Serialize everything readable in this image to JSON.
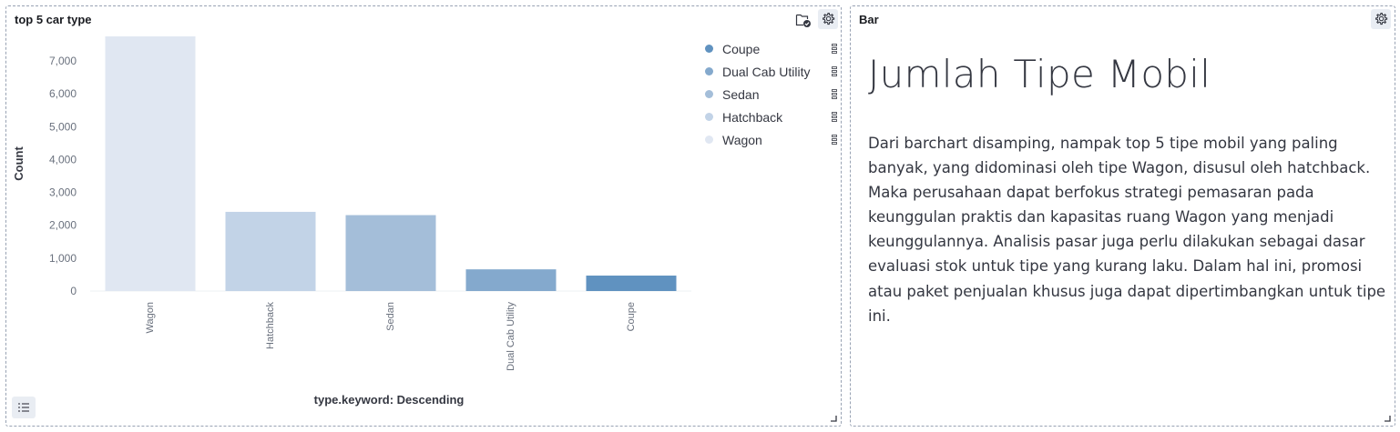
{
  "left_panel": {
    "title": "top 5 car type",
    "x_axis_title": "type.keyword: Descending",
    "y_axis_title": "Count",
    "legend": [
      {
        "label": "Coupe",
        "color": "#6092c0"
      },
      {
        "label": "Dual Cab Utility",
        "color": "#84a9cd"
      },
      {
        "label": "Sedan",
        "color": "#a4bed9"
      },
      {
        "label": "Hatchback",
        "color": "#c2d3e7"
      },
      {
        "label": "Wagon",
        "color": "#e0e7f2"
      }
    ]
  },
  "right_panel": {
    "title": "Bar",
    "heading": "Jumlah Tipe Mobil",
    "paragraph": "Dari barchart disamping, nampak top 5 tipe mobil yang paling banyak, yang didominasi oleh tipe Wagon, disusul oleh hatchback. Maka perusahaan dapat berfokus strategi pemasaran pada keunggulan praktis dan kapasitas ruang Wagon yang menjadi keunggulannya. Analisis pasar juga perlu dilakukan sebagai dasar evaluasi stok untuk tipe yang kurang laku. Dalam hal ini, promosi atau paket penjualan khusus juga dapat dipertimbangkan untuk tipe ini."
  },
  "chart_data": {
    "type": "bar",
    "title": "top 5 car type",
    "xlabel": "type.keyword: Descending",
    "ylabel": "Count",
    "categories": [
      "Wagon",
      "Hatchback",
      "Sedan",
      "Dual Cab Utility",
      "Coupe"
    ],
    "values": [
      7750,
      2410,
      2310,
      660,
      470
    ],
    "colors": [
      "#e0e7f2",
      "#c2d3e7",
      "#a4bed9",
      "#84a9cd",
      "#6092c0"
    ],
    "yticks": [
      0,
      1000,
      2000,
      3000,
      4000,
      5000,
      6000,
      7000
    ],
    "ytick_labels": [
      "0",
      "1,000",
      "2,000",
      "3,000",
      "4,000",
      "5,000",
      "6,000",
      "7,000"
    ],
    "ylim": [
      0,
      7750
    ],
    "grid": false,
    "legend_position": "top-right"
  }
}
